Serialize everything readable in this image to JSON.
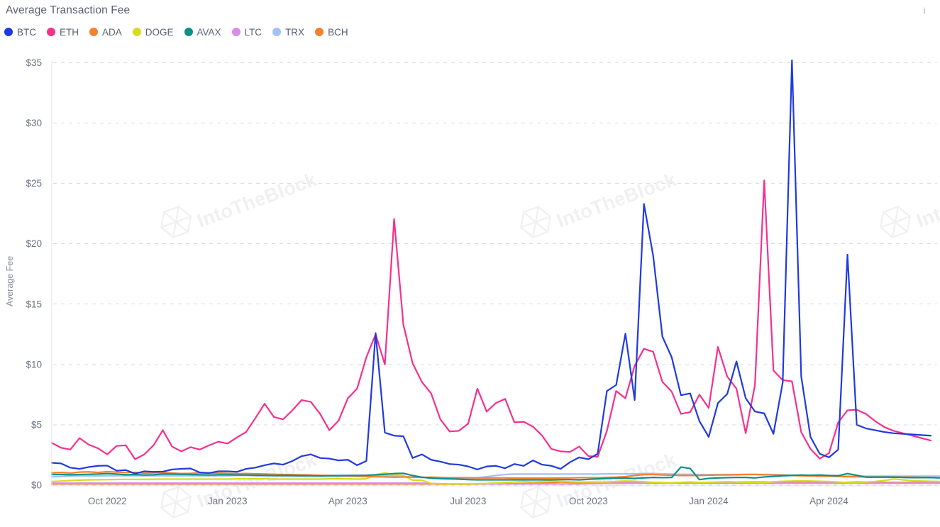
{
  "header": {
    "title": "Average Transaction Fee",
    "info_icon": "info-icon"
  },
  "watermark": {
    "text": "IntoTheBlock"
  },
  "legend": [
    {
      "label": "BTC",
      "color": "#1f3ae0"
    },
    {
      "label": "ETH",
      "color": "#f5308e"
    },
    {
      "label": "ADA",
      "color": "#f4812f"
    },
    {
      "label": "DOGE",
      "color": "#d8dc1c"
    },
    {
      "label": "AVAX",
      "color": "#0f8f88"
    },
    {
      "label": "LTC",
      "color": "#d88ce8"
    },
    {
      "label": "TRX",
      "color": "#a3c2f2"
    },
    {
      "label": "BCH",
      "color": "#f4812f"
    }
  ],
  "chart_data": {
    "type": "line",
    "title": "Average Transaction Fee",
    "xlabel": "",
    "ylabel": "Average Fee",
    "ylim": [
      0,
      35.2
    ],
    "yticks": [
      0,
      5,
      10,
      15,
      20,
      25,
      30,
      35
    ],
    "ytick_labels": [
      "$0",
      "$5",
      "$10",
      "$15",
      "$20",
      "$25",
      "$30",
      "$35"
    ],
    "grid": true,
    "legend_position": "top-left",
    "x_start": "2022-08-21",
    "x_end": "2024-06-16",
    "x_step_days": 7,
    "n_points": 97,
    "xticks": [
      {
        "label": "Oct 2022",
        "index": 6
      },
      {
        "label": "Jan 2023",
        "index": 19
      },
      {
        "label": "Apr 2023",
        "index": 32
      },
      {
        "label": "Jul 2023",
        "index": 45
      },
      {
        "label": "Oct 2023",
        "index": 58
      },
      {
        "label": "Jan 2024",
        "index": 71
      },
      {
        "label": "Apr 2024",
        "index": 84
      }
    ],
    "series": [
      {
        "name": "BTC",
        "color": "#1f3ae0",
        "values": [
          1.85,
          1.8,
          1.45,
          1.35,
          1.5,
          1.6,
          1.62,
          1.2,
          1.25,
          0.95,
          1.15,
          1.1,
          1.12,
          1.3,
          1.35,
          1.38,
          1.05,
          1.0,
          1.15,
          1.15,
          1.1,
          1.35,
          1.45,
          1.65,
          1.8,
          1.7,
          2.0,
          2.4,
          2.55,
          2.25,
          2.2,
          2.05,
          2.1,
          1.65,
          2.0,
          12.6,
          4.35,
          4.1,
          4.05,
          2.25,
          2.55,
          2.1,
          1.95,
          1.75,
          1.7,
          1.55,
          1.3,
          1.55,
          1.6,
          1.4,
          1.75,
          1.6,
          2.05,
          1.7,
          1.6,
          1.35,
          1.9,
          2.3,
          2.15,
          2.6,
          7.8,
          8.3,
          12.55,
          7.05,
          23.3,
          19.0,
          12.3,
          10.6,
          7.45,
          7.6,
          5.3,
          4.0,
          6.8,
          7.55,
          10.25,
          7.2,
          6.1,
          5.95,
          4.25,
          8.5,
          35.2,
          9.0,
          4.0,
          2.6,
          2.3,
          2.95,
          19.1,
          5.0,
          4.7,
          4.55,
          4.4,
          4.3,
          4.25,
          4.2,
          4.15,
          4.1
        ]
      },
      {
        "name": "ETH",
        "color": "#f5308e",
        "values": [
          3.5,
          3.1,
          2.95,
          3.9,
          3.35,
          3.05,
          2.55,
          3.25,
          3.3,
          2.15,
          2.55,
          3.3,
          4.55,
          3.2,
          2.8,
          3.15,
          2.95,
          3.3,
          3.6,
          3.45,
          3.95,
          4.4,
          5.55,
          6.75,
          5.65,
          5.45,
          6.2,
          7.05,
          6.9,
          5.9,
          4.55,
          5.35,
          7.2,
          8.0,
          10.6,
          12.5,
          10.0,
          22.05,
          13.3,
          10.1,
          8.55,
          7.6,
          5.45,
          4.45,
          4.5,
          5.1,
          8.0,
          6.1,
          6.8,
          7.15,
          5.2,
          5.25,
          4.85,
          4.1,
          3.0,
          2.8,
          2.75,
          3.2,
          2.4,
          2.35,
          4.5,
          7.8,
          7.2,
          9.9,
          11.3,
          11.05,
          8.55,
          7.75,
          5.9,
          6.05,
          7.5,
          6.4,
          11.45,
          9.0,
          8.0,
          4.3,
          8.3,
          25.25,
          9.5,
          8.7,
          8.6,
          4.4,
          3.0,
          2.2,
          2.65,
          5.2,
          6.2,
          6.25,
          5.9,
          5.3,
          4.8,
          4.5,
          4.3,
          4.1,
          3.9,
          3.7
        ]
      },
      {
        "name": "ADA",
        "color": "#f4812f",
        "values": [
          1.02,
          1.05,
          1.0,
          1.08,
          1.1,
          1.05,
          1.12,
          1.08,
          1.04,
          1.06,
          1.0,
          1.02,
          1.05,
          1.0,
          0.96,
          0.98,
          1.02,
          1.0,
          1.0,
          0.98,
          0.95,
          0.96,
          0.94,
          0.92,
          0.9,
          0.88,
          0.87,
          0.86,
          0.84,
          0.82,
          0.8,
          0.78,
          0.76,
          0.74,
          0.72,
          0.7,
          0.68,
          0.66,
          0.68,
          0.66,
          0.64,
          0.66,
          0.64,
          0.62,
          0.62,
          0.62,
          0.6,
          0.6,
          0.6,
          0.6,
          0.58,
          0.58,
          0.58,
          0.58,
          0.58,
          0.6,
          0.6,
          0.62,
          0.62,
          0.62,
          0.64,
          0.66,
          0.7,
          0.8,
          0.88,
          0.88,
          0.84,
          0.82,
          0.8,
          0.8,
          0.8,
          0.82,
          0.84,
          0.84,
          0.86,
          0.88,
          0.88,
          0.86,
          0.84,
          0.82,
          0.8,
          0.78,
          0.76,
          0.74,
          0.74,
          0.72,
          0.7,
          0.7,
          0.68,
          0.68,
          0.68,
          0.66,
          0.66,
          0.66,
          0.64,
          0.64
        ]
      },
      {
        "name": "DOGE",
        "color": "#d8dc1c",
        "values": [
          0.3,
          0.34,
          0.38,
          0.42,
          0.44,
          0.45,
          0.46,
          0.47,
          0.48,
          0.48,
          0.48,
          0.49,
          0.5,
          0.5,
          0.5,
          0.5,
          0.5,
          0.5,
          0.5,
          0.5,
          0.52,
          0.52,
          0.52,
          0.52,
          0.5,
          0.5,
          0.5,
          0.5,
          0.5,
          0.5,
          0.52,
          0.52,
          0.52,
          0.5,
          0.52,
          0.86,
          1.02,
          0.85,
          0.8,
          0.42,
          0.4,
          0.14,
          0.1,
          0.1,
          0.1,
          0.1,
          0.12,
          0.14,
          0.18,
          0.22,
          0.26,
          0.3,
          0.26,
          0.3,
          0.34,
          0.32,
          0.28,
          0.26,
          0.26,
          0.26,
          0.26,
          0.3,
          0.34,
          0.32,
          0.28,
          0.24,
          0.22,
          0.2,
          0.24,
          0.26,
          0.22,
          0.24,
          0.26,
          0.28,
          0.26,
          0.24,
          0.22,
          0.22,
          0.28,
          0.32,
          0.34,
          0.36,
          0.34,
          0.32,
          0.3,
          0.26,
          0.22,
          0.22,
          0.26,
          0.3,
          0.38,
          0.52,
          0.44,
          0.36,
          0.34,
          0.32,
          0.3
        ]
      },
      {
        "name": "AVAX",
        "color": "#0f8f88",
        "values": [
          0.88,
          0.88,
          0.86,
          0.88,
          0.9,
          0.92,
          0.96,
          0.92,
          0.86,
          0.88,
          0.84,
          0.86,
          0.92,
          0.92,
          0.9,
          0.88,
          0.86,
          0.84,
          0.86,
          0.86,
          0.84,
          0.84,
          0.82,
          0.82,
          0.8,
          0.8,
          0.8,
          0.78,
          0.78,
          0.76,
          0.78,
          0.78,
          0.8,
          0.8,
          0.82,
          0.86,
          0.9,
          0.96,
          0.98,
          0.8,
          0.66,
          0.58,
          0.54,
          0.52,
          0.5,
          0.46,
          0.44,
          0.44,
          0.44,
          0.44,
          0.44,
          0.44,
          0.44,
          0.44,
          0.44,
          0.46,
          0.46,
          0.44,
          0.48,
          0.52,
          0.56,
          0.58,
          0.58,
          0.56,
          0.6,
          0.64,
          0.62,
          0.64,
          1.5,
          1.38,
          0.46,
          0.56,
          0.6,
          0.62,
          0.64,
          0.64,
          0.6,
          0.68,
          0.72,
          0.78,
          0.8,
          0.84,
          0.82,
          0.84,
          0.8,
          0.78,
          0.96,
          0.82,
          0.66,
          0.66,
          0.66,
          0.66,
          0.64,
          0.62,
          0.62,
          0.62,
          0.6
        ]
      },
      {
        "name": "LTC",
        "color": "#d88ce8",
        "values": [
          0.16,
          0.16,
          0.16,
          0.16,
          0.16,
          0.16,
          0.16,
          0.16,
          0.16,
          0.16,
          0.16,
          0.16,
          0.16,
          0.16,
          0.16,
          0.16,
          0.16,
          0.16,
          0.16,
          0.16,
          0.16,
          0.16,
          0.16,
          0.16,
          0.16,
          0.16,
          0.16,
          0.16,
          0.16,
          0.16,
          0.16,
          0.16,
          0.16,
          0.16,
          0.16,
          0.16,
          0.16,
          0.16,
          0.16,
          0.16,
          0.16,
          0.14,
          0.12,
          0.1,
          0.1,
          0.1,
          0.1,
          0.1,
          0.1,
          0.1,
          0.1,
          0.1,
          0.1,
          0.1,
          0.1,
          0.1,
          0.1,
          0.1,
          0.12,
          0.14,
          0.16,
          0.16,
          0.16,
          0.16,
          0.16,
          0.16,
          0.16,
          0.16,
          0.16,
          0.16,
          0.16,
          0.16,
          0.16,
          0.16,
          0.16,
          0.16,
          0.16,
          0.16,
          0.16,
          0.16,
          0.16,
          0.16,
          0.16,
          0.16,
          0.16,
          0.16,
          0.16,
          0.16,
          0.16,
          0.16,
          0.16,
          0.16,
          0.16,
          0.16,
          0.16,
          0.16,
          0.16
        ]
      },
      {
        "name": "TRX",
        "color": "#a3c2f2",
        "values": [
          0.7,
          0.72,
          0.74,
          0.76,
          0.76,
          0.76,
          0.78,
          0.78,
          0.78,
          0.78,
          0.78,
          0.78,
          0.78,
          0.78,
          0.78,
          0.78,
          0.78,
          0.76,
          0.78,
          0.78,
          0.8,
          0.8,
          0.78,
          0.76,
          0.78,
          0.76,
          0.74,
          0.76,
          0.78,
          0.78,
          0.8,
          0.82,
          0.8,
          0.8,
          0.8,
          0.8,
          0.78,
          0.76,
          0.72,
          0.68,
          0.64,
          0.6,
          0.58,
          0.56,
          0.54,
          0.56,
          0.62,
          0.7,
          0.8,
          0.88,
          0.92,
          0.92,
          0.92,
          0.92,
          0.92,
          0.92,
          0.92,
          0.92,
          0.92,
          0.92,
          0.94,
          0.94,
          0.94,
          0.94,
          0.96,
          0.96,
          0.94,
          0.92,
          0.9,
          0.9,
          0.88,
          0.88,
          0.88,
          0.88,
          0.88,
          0.9,
          0.9,
          0.88,
          0.88,
          0.86,
          0.84,
          0.82,
          0.8,
          0.78,
          0.76,
          0.74,
          0.74,
          0.74,
          0.74,
          0.74,
          0.74,
          0.74,
          0.74,
          0.74,
          0.74,
          0.74,
          0.74
        ]
      },
      {
        "name": "BCH",
        "color": "#f4812f",
        "values": [
          0.1,
          0.1,
          0.1,
          0.1,
          0.1,
          0.1,
          0.1,
          0.1,
          0.1,
          0.1,
          0.1,
          0.1,
          0.1,
          0.1,
          0.1,
          0.1,
          0.1,
          0.1,
          0.1,
          0.1,
          0.1,
          0.1,
          0.1,
          0.1,
          0.1,
          0.1,
          0.1,
          0.1,
          0.1,
          0.1,
          0.1,
          0.1,
          0.1,
          0.1,
          0.1,
          0.1,
          0.1,
          0.1,
          0.1,
          0.1,
          0.1,
          0.1,
          0.08,
          0.08,
          0.08,
          0.08,
          0.1,
          0.12,
          0.12,
          0.12,
          0.12,
          0.14,
          0.16,
          0.16,
          0.2,
          0.26,
          0.22,
          0.2,
          0.2,
          0.2,
          0.2,
          0.22,
          0.2,
          0.22,
          0.18,
          0.16,
          0.18,
          0.18,
          0.2,
          0.2,
          0.2,
          0.22,
          0.22,
          0.24,
          0.26,
          0.26,
          0.26,
          0.26,
          0.26,
          0.24,
          0.24,
          0.22,
          0.22,
          0.2,
          0.2,
          0.22,
          0.24,
          0.26,
          0.26,
          0.24,
          0.22,
          0.22,
          0.22,
          0.22,
          0.22,
          0.22,
          0.22
        ]
      }
    ]
  }
}
